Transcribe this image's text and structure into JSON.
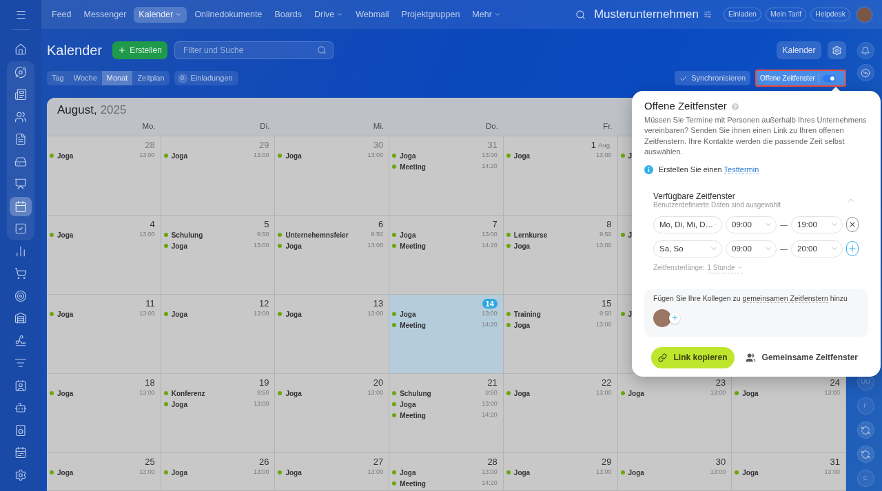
{
  "sidebar": {
    "top_items": [
      {
        "selected": false
      }
    ],
    "group_items": [
      {
        "selected": false
      },
      {
        "selected": false
      },
      {
        "selected": false
      },
      {
        "selected": false
      },
      {
        "selected": false
      },
      {
        "selected": false
      },
      {
        "selected": true
      },
      {
        "selected": false
      }
    ],
    "items": [
      {
        "selected": false
      },
      {
        "selected": false
      },
      {
        "selected": false
      },
      {
        "selected": false
      },
      {
        "selected": false
      },
      {
        "selected": false
      },
      {
        "selected": false
      },
      {
        "selected": false
      },
      {
        "selected": false
      },
      {
        "selected": false
      },
      {
        "selected": false
      }
    ]
  },
  "top_nav": {
    "items": [
      {
        "label": "Feed",
        "selected": false,
        "dropdown": false
      },
      {
        "label": "Messenger",
        "selected": false,
        "dropdown": false
      },
      {
        "label": "Kalender",
        "selected": true,
        "dropdown": true
      },
      {
        "label": "Onlinedokumente",
        "selected": false,
        "dropdown": false
      },
      {
        "label": "Boards",
        "selected": false,
        "dropdown": false
      },
      {
        "label": "Drive",
        "selected": false,
        "dropdown": true
      },
      {
        "label": "Webmail",
        "selected": false,
        "dropdown": false
      },
      {
        "label": "Projektgruppen",
        "selected": false,
        "dropdown": false
      },
      {
        "label": "Mehr",
        "selected": false,
        "dropdown": true
      }
    ]
  },
  "account": {
    "company": "Musterunternehmen",
    "buttons": [
      "Einladen",
      "Mein Tarif",
      "Helpdesk"
    ]
  },
  "header": {
    "title": "Kalender",
    "create_button": "Erstellen",
    "search": {
      "placeholder": "Filter und Suche"
    },
    "calendar_button": "Kalender"
  },
  "toolbar": {
    "views": [
      {
        "label": "Tag",
        "selected": false
      },
      {
        "label": "Woche",
        "selected": false
      },
      {
        "label": "Monat",
        "selected": true
      },
      {
        "label": "Zeitplan",
        "selected": false
      }
    ],
    "invitations": {
      "count": "0",
      "label": "Einladungen"
    },
    "sync_button": "Synchronisieren",
    "open_slots": {
      "label": "Offene Zeitfenster",
      "on": true,
      "highlighted": true
    }
  },
  "calendar": {
    "month": "August,",
    "year": "2025",
    "weekdays": [
      "Mo.",
      "Di.",
      "Mi.",
      "Do.",
      "Fr."
    ],
    "weeks": [
      {
        "days": [
          {
            "day": "28",
            "other_month": true,
            "today": false,
            "events": [
              {
                "title": "Joga",
                "time": "13:00"
              }
            ]
          },
          {
            "day": "29",
            "other_month": true,
            "today": false,
            "events": [
              {
                "title": "Joga",
                "time": "13:00"
              }
            ]
          },
          {
            "day": "30",
            "other_month": true,
            "today": false,
            "events": [
              {
                "title": "Joga",
                "time": "13:00"
              }
            ]
          },
          {
            "day": "31",
            "other_month": true,
            "today": false,
            "events": [
              {
                "title": "Joga",
                "time": "13:00"
              },
              {
                "title": "Meeting",
                "time": "14:20"
              }
            ]
          },
          {
            "day": "1",
            "month_label": "Aug.",
            "other_month": false,
            "today": false,
            "events": [
              {
                "title": "Joga",
                "time": "13:00"
              }
            ]
          },
          {
            "events": [
              {
                "title": "J"
              }
            ]
          }
        ]
      },
      {
        "days": [
          {
            "day": "4",
            "other_month": false,
            "today": false,
            "events": [
              {
                "title": "Joga",
                "time": "13:00"
              }
            ]
          },
          {
            "day": "5",
            "other_month": false,
            "today": false,
            "events": [
              {
                "title": "Schulung",
                "time": "9:50"
              },
              {
                "title": "Joga",
                "time": "13:00"
              }
            ]
          },
          {
            "day": "6",
            "other_month": false,
            "today": false,
            "events": [
              {
                "title": "Unternehemnsfeier",
                "time": "9:50"
              },
              {
                "title": "Joga",
                "time": "13:00"
              }
            ]
          },
          {
            "day": "7",
            "other_month": false,
            "today": false,
            "events": [
              {
                "title": "Joga",
                "time": "13:00"
              },
              {
                "title": "Meeting",
                "time": "14:20"
              }
            ]
          },
          {
            "day": "8",
            "other_month": false,
            "today": false,
            "events": [
              {
                "title": "Lernkurse",
                "time": "9:50"
              },
              {
                "title": "Joga",
                "time": "13:00"
              }
            ]
          },
          {
            "events": [
              {
                "title": "J"
              }
            ]
          }
        ]
      },
      {
        "days": [
          {
            "day": "11",
            "other_month": false,
            "today": false,
            "events": [
              {
                "title": "Joga",
                "time": "13:00"
              }
            ]
          },
          {
            "day": "12",
            "other_month": false,
            "today": false,
            "events": [
              {
                "title": "Joga",
                "time": "13:00"
              }
            ]
          },
          {
            "day": "13",
            "other_month": false,
            "today": false,
            "events": [
              {
                "title": "Joga",
                "time": "13:00"
              }
            ]
          },
          {
            "day": "14",
            "other_month": false,
            "today": true,
            "events": [
              {
                "title": "Joga",
                "time": "13:00"
              },
              {
                "title": "Meeting",
                "time": "14:20"
              }
            ]
          },
          {
            "day": "15",
            "other_month": false,
            "today": false,
            "events": [
              {
                "title": "Training",
                "time": "9:50"
              },
              {
                "title": "Joga",
                "time": "13:00"
              }
            ]
          },
          {
            "events": [
              {
                "title": "J"
              }
            ]
          }
        ]
      },
      {
        "days": [
          {
            "day": "18",
            "other_month": false,
            "today": false,
            "events": [
              {
                "title": "Joga",
                "time": "13:00"
              }
            ]
          },
          {
            "day": "19",
            "other_month": false,
            "today": false,
            "events": [
              {
                "title": "Konferenz",
                "time": "9:50"
              },
              {
                "title": "Joga",
                "time": "13:00"
              }
            ]
          },
          {
            "day": "20",
            "other_month": false,
            "today": false,
            "events": [
              {
                "title": "Joga",
                "time": "13:00"
              }
            ]
          },
          {
            "day": "21",
            "other_month": false,
            "today": false,
            "events": [
              {
                "title": "Schulung",
                "time": "9:50"
              },
              {
                "title": "Joga",
                "time": "13:00"
              },
              {
                "title": "Meeting",
                "time": "14:20"
              }
            ]
          },
          {
            "day": "22",
            "other_month": false,
            "today": false,
            "events": [
              {
                "title": "Joga",
                "time": "13:00"
              }
            ]
          },
          {
            "day": "23",
            "other_month": false,
            "today": false,
            "events": [
              {
                "title": "Joga",
                "time": "13:00"
              }
            ]
          },
          {
            "day": "24",
            "other_month": false,
            "today": false,
            "events": [
              {
                "title": "Joga",
                "time": "13:00"
              }
            ]
          }
        ]
      },
      {
        "days": [
          {
            "day": "25",
            "other_month": false,
            "today": false,
            "events": [
              {
                "title": "Joga",
                "time": "13:00"
              }
            ]
          },
          {
            "day": "26",
            "other_month": false,
            "today": false,
            "events": [
              {
                "title": "Joga",
                "time": "13:00"
              }
            ]
          },
          {
            "day": "27",
            "other_month": false,
            "today": false,
            "events": [
              {
                "title": "Joga",
                "time": "13:00"
              }
            ]
          },
          {
            "day": "28",
            "other_month": false,
            "today": false,
            "events": [
              {
                "title": "Joga",
                "time": "13:00"
              },
              {
                "title": "Meeting",
                "time": "14:20"
              }
            ]
          },
          {
            "day": "29",
            "other_month": false,
            "today": false,
            "events": [
              {
                "title": "Joga",
                "time": "13:00"
              }
            ]
          },
          {
            "day": "30",
            "other_month": false,
            "today": false,
            "events": [
              {
                "title": "Joga",
                "time": "13:00"
              }
            ]
          },
          {
            "day": "31",
            "other_month": false,
            "today": false,
            "events": [
              {
                "title": "Joga",
                "time": "13:00"
              }
            ]
          }
        ]
      }
    ]
  },
  "right_rail": {
    "top_items": [
      {
        "kind": "icon"
      },
      {
        "kind": "icon"
      }
    ],
    "bottom_items": [
      {
        "kind": "initials",
        "text": "UU"
      },
      {
        "kind": "initials",
        "text": "F"
      },
      {
        "kind": "icon"
      },
      {
        "kind": "icon"
      },
      {
        "kind": "initials",
        "text": "C"
      }
    ]
  },
  "popup": {
    "title": "Offene Zeitfenster",
    "description": "Müssen Sie Termine mit Personen außerhalb Ihres Unternehmens vereinbaren? Senden Sie ihnen einen Link zu Ihren offenen Zeitfenstern. Ihre Kontakte werden die passende Zeit selbst auswählen.",
    "info": {
      "text": "Erstellen Sie einen",
      "link": "Testtermin"
    },
    "slots": {
      "title": "Verfügbare Zeitfenster",
      "subtitle": "Benutzerdefinierte Daten sind ausgewählt",
      "expanded": true,
      "rows": [
        {
          "days": "Mo, Di, Mi, D…",
          "from": "09:00",
          "separator": "—",
          "to": "19:00",
          "button": {
            "kind": "remove"
          }
        },
        {
          "days": "Sa, So",
          "from": "09:00",
          "separator": "—",
          "to": "20:00",
          "button": {
            "kind": "add"
          }
        }
      ],
      "length_label": "Zeitfensterlänge:",
      "length_value": "1 Stunde"
    },
    "colleagues": {
      "text_before": "Fügen Sie Ihre Kollegen zu",
      "link": "gemeinsamen Zeitfenstern",
      "text_after": "hinzu"
    },
    "buttons": [
      {
        "label": "Link kopieren",
        "kind": "primary"
      },
      {
        "label": "Gemeinsame Zeitfenster",
        "kind": "secondary"
      }
    ]
  }
}
